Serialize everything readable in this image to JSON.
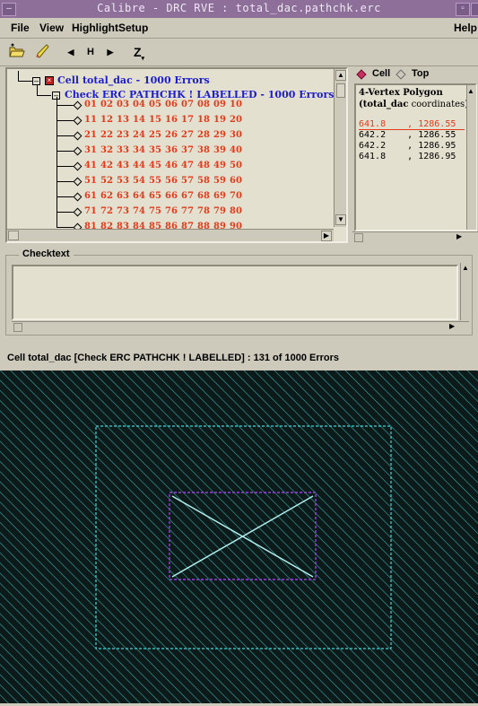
{
  "window": {
    "title": "Calibre - DRC RVE : total_dac.pathchk.erc",
    "minimize_glyph": "–",
    "close_glyph": "▫"
  },
  "menu": {
    "file": "File",
    "view": "View",
    "highlight": "Highlight",
    "setup": "Setup",
    "help": "Help"
  },
  "toolbar": {
    "open_icon": "folder-open-icon",
    "pencil_icon": "highlight-pencil-icon",
    "prev_label": "◀",
    "h_label": "H",
    "next_label": "▶",
    "zoom_label": "Z"
  },
  "tree": {
    "cell_label": "Cell total_dac - 1000 Errors",
    "check_label": "Check ERC PATHCHK ! LABELLED - 1000 Errors",
    "error_rows": [
      [
        "01",
        "02",
        "03",
        "04",
        "05",
        "06",
        "07",
        "08",
        "09",
        "10"
      ],
      [
        "11",
        "12",
        "13",
        "14",
        "15",
        "16",
        "17",
        "18",
        "19",
        "20"
      ],
      [
        "21",
        "22",
        "23",
        "24",
        "25",
        "26",
        "27",
        "28",
        "29",
        "30"
      ],
      [
        "31",
        "32",
        "33",
        "34",
        "35",
        "36",
        "37",
        "38",
        "39",
        "40"
      ],
      [
        "41",
        "42",
        "43",
        "44",
        "45",
        "46",
        "47",
        "48",
        "49",
        "50"
      ],
      [
        "51",
        "52",
        "53",
        "54",
        "55",
        "56",
        "57",
        "58",
        "59",
        "60"
      ],
      [
        "61",
        "62",
        "63",
        "64",
        "65",
        "66",
        "67",
        "68",
        "69",
        "70"
      ],
      [
        "71",
        "72",
        "73",
        "74",
        "75",
        "76",
        "77",
        "78",
        "79",
        "80"
      ],
      [
        "81",
        "82",
        "83",
        "84",
        "85",
        "86",
        "87",
        "88",
        "89",
        "90"
      ]
    ]
  },
  "coords_panel": {
    "cell_option": "Cell",
    "top_option": "Top",
    "heading": "4-Vertex Polygon",
    "sub_heading_bold": "(total_dac",
    "sub_heading_rest": " coordinates)",
    "rows": [
      {
        "x": "641.8",
        "y": "1286.55"
      },
      {
        "x": "642.2",
        "y": "1286.55"
      },
      {
        "x": "642.2",
        "y": "1286.95"
      },
      {
        "x": "641.8",
        "y": "1286.95"
      }
    ]
  },
  "checktext": {
    "label": "Checktext"
  },
  "status": {
    "text": "Cell total_dac [Check ERC PATHCHK ! LABELLED] : 131 of 1000 Errors"
  },
  "colors": {
    "title_bar": "#8d6f9a",
    "error_number": "#e43a1c",
    "tree_label": "#1c1cd0",
    "selected_coord": "#e43a1c",
    "layout_outer_box": "#40d8d8",
    "layout_inner_box": "#9a40e0",
    "layout_cross": "#b0ecec",
    "canvas_bg": "#0d1a1a"
  }
}
